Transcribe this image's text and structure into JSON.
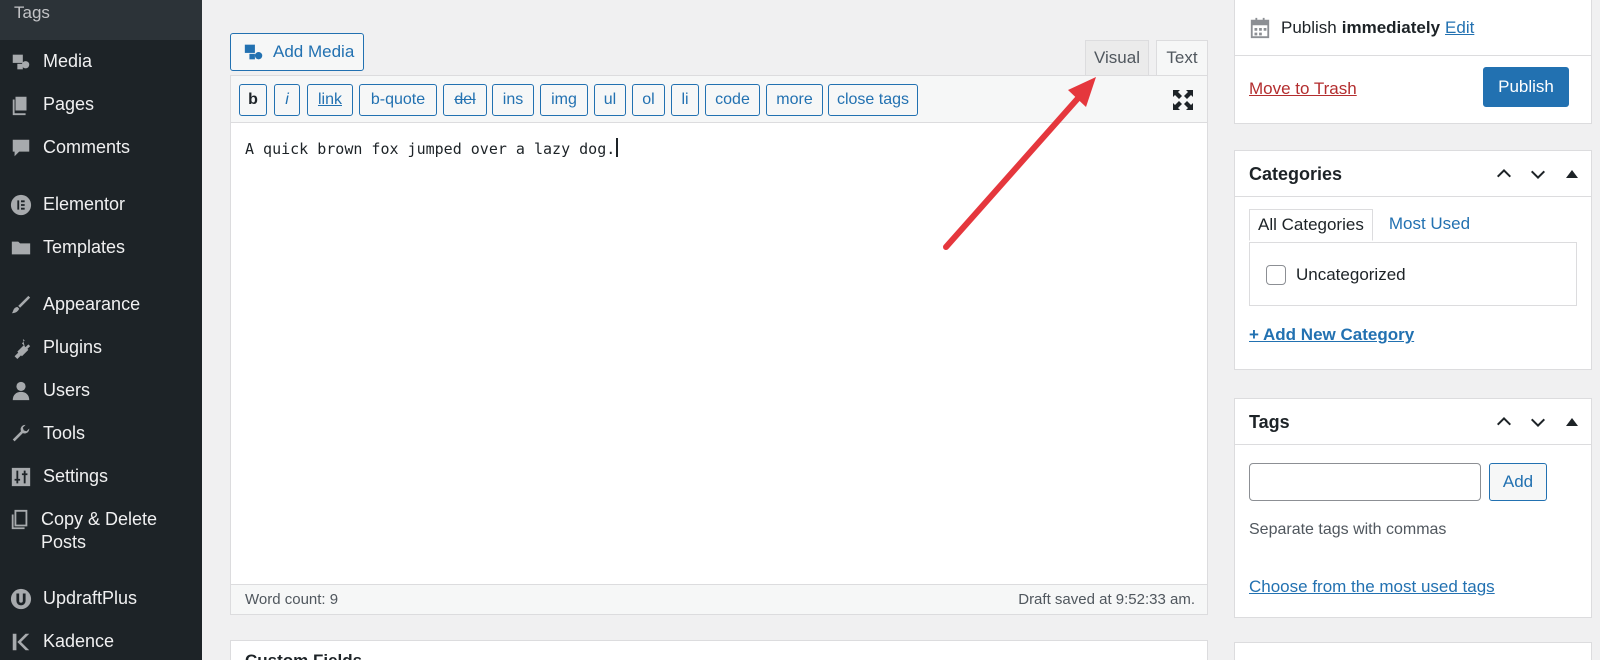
{
  "sidebar": {
    "top_label": "Tags",
    "items": [
      {
        "label": "Media",
        "icon": "media-icon"
      },
      {
        "label": "Pages",
        "icon": "pages-icon"
      },
      {
        "label": "Comments",
        "icon": "comments-icon"
      },
      {
        "label": "Elementor",
        "icon": "elementor-icon"
      },
      {
        "label": "Templates",
        "icon": "folder-icon"
      },
      {
        "label": "Appearance",
        "icon": "paintbrush-icon"
      },
      {
        "label": "Plugins",
        "icon": "plugin-icon"
      },
      {
        "label": "Users",
        "icon": "user-icon"
      },
      {
        "label": "Tools",
        "icon": "wrench-icon"
      },
      {
        "label": "Settings",
        "icon": "settings-sliders-icon"
      },
      {
        "label": "Copy & Delete Posts",
        "icon": "copy-icon"
      },
      {
        "label": "UpdraftPlus",
        "icon": "updraft-icon"
      },
      {
        "label": "Kadence",
        "icon": "kadence-icon"
      }
    ]
  },
  "editor": {
    "add_media_label": "Add Media",
    "tabs": {
      "visual": "Visual",
      "text": "Text"
    },
    "quicktags": [
      "b",
      "i",
      "link",
      "b-quote",
      "del",
      "ins",
      "img",
      "ul",
      "ol",
      "li",
      "code",
      "more",
      "close tags"
    ],
    "content": "A quick brown fox jumped over a lazy dog.",
    "word_count": "Word count: 9",
    "draft_saved": "Draft saved at 9:52:33 am.",
    "custom_fields_title": "Custom Fields"
  },
  "publish": {
    "publish_prefix": "Publish",
    "publish_when": "immediately",
    "edit_label": "Edit",
    "trash_label": "Move to Trash",
    "publish_button": "Publish"
  },
  "categories": {
    "title": "Categories",
    "tab_all": "All Categories",
    "tab_most_used": "Most Used",
    "items": [
      "Uncategorized"
    ],
    "add_new": "+ Add New Category"
  },
  "tags": {
    "title": "Tags",
    "input_value": "",
    "add_button": "Add",
    "hint": "Separate tags with commas",
    "choose_link": "Choose from the most used tags"
  },
  "colors": {
    "sidebar_bg": "#1d2327",
    "accent": "#2271b1",
    "trash": "#b32d2e",
    "arrow": "#e5373d"
  }
}
